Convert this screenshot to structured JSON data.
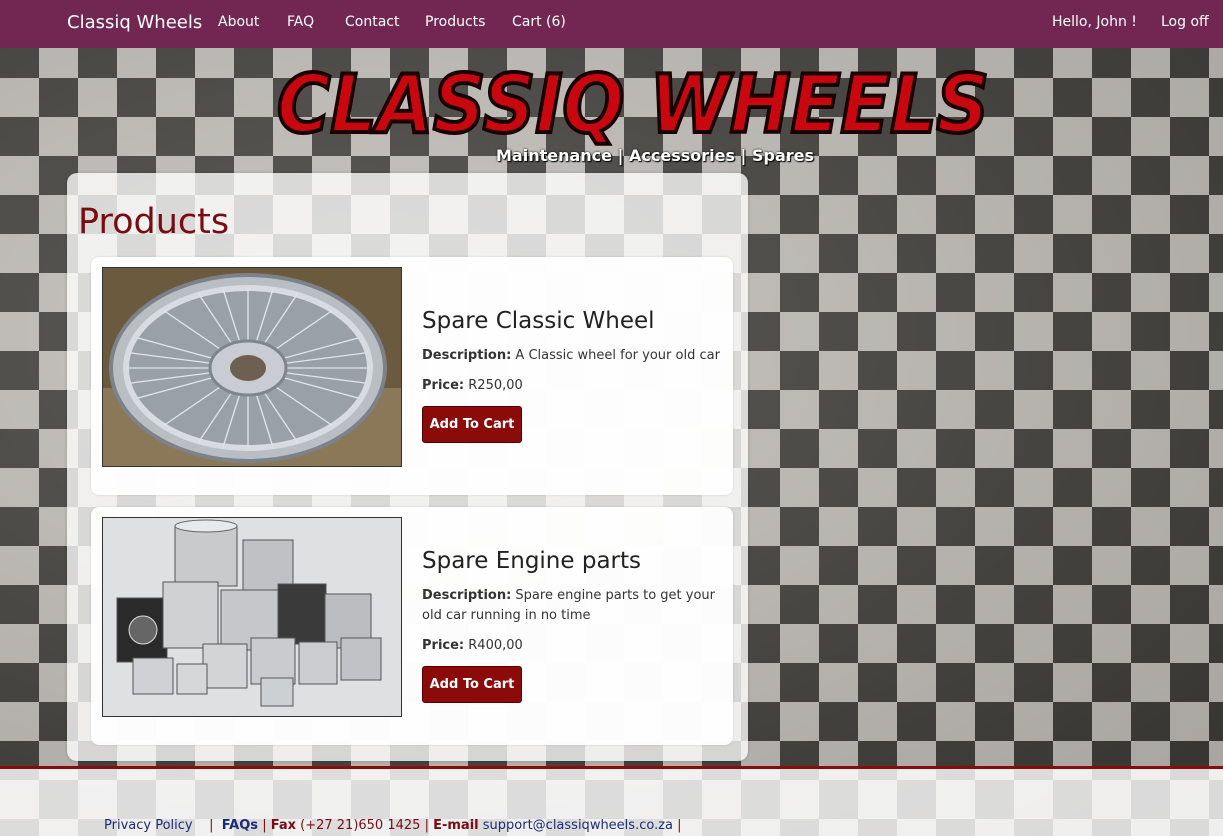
{
  "nav": {
    "brand": "Classiq Wheels",
    "links": [
      "About",
      "FAQ",
      "Contact",
      "Products",
      "Cart (6)"
    ],
    "greeting": "Hello, John !",
    "logoff": "Log off",
    "bg_color": "#722752"
  },
  "header": {
    "logo_text": "CLASSIQ WHEELS",
    "tagline": "Maintenance | Accessories | Spares"
  },
  "page": {
    "title": "Products"
  },
  "products": [
    {
      "name": "Spare Classic Wheel",
      "description_label": "Description:",
      "description": "A Classic wheel for your old car",
      "price_label": "Price:",
      "price": "R250,00",
      "button": "Add To Cart",
      "image_icon": "wire-wheel-image"
    },
    {
      "name": "Spare Engine parts",
      "description_label": "Description:",
      "description": "Spare engine parts to get your old car running in no time",
      "price_label": "Price:",
      "price": "R400,00",
      "button": "Add To Cart",
      "image_icon": "pistons-image"
    }
  ],
  "footer": {
    "privacy": "Privacy Policy",
    "sep1": "|",
    "faqs": "FAQs",
    "sep2": "|",
    "fax_label": "Fax",
    "fax": "(+27 21)650 1425",
    "sep3": "|",
    "email_label": "E-mail",
    "email": "support@classiqwheels.co.za",
    "sep4": "|"
  },
  "colors": {
    "accent": "#8b0a0a",
    "title": "#7a0b12",
    "logo_red": "#c8070f"
  }
}
